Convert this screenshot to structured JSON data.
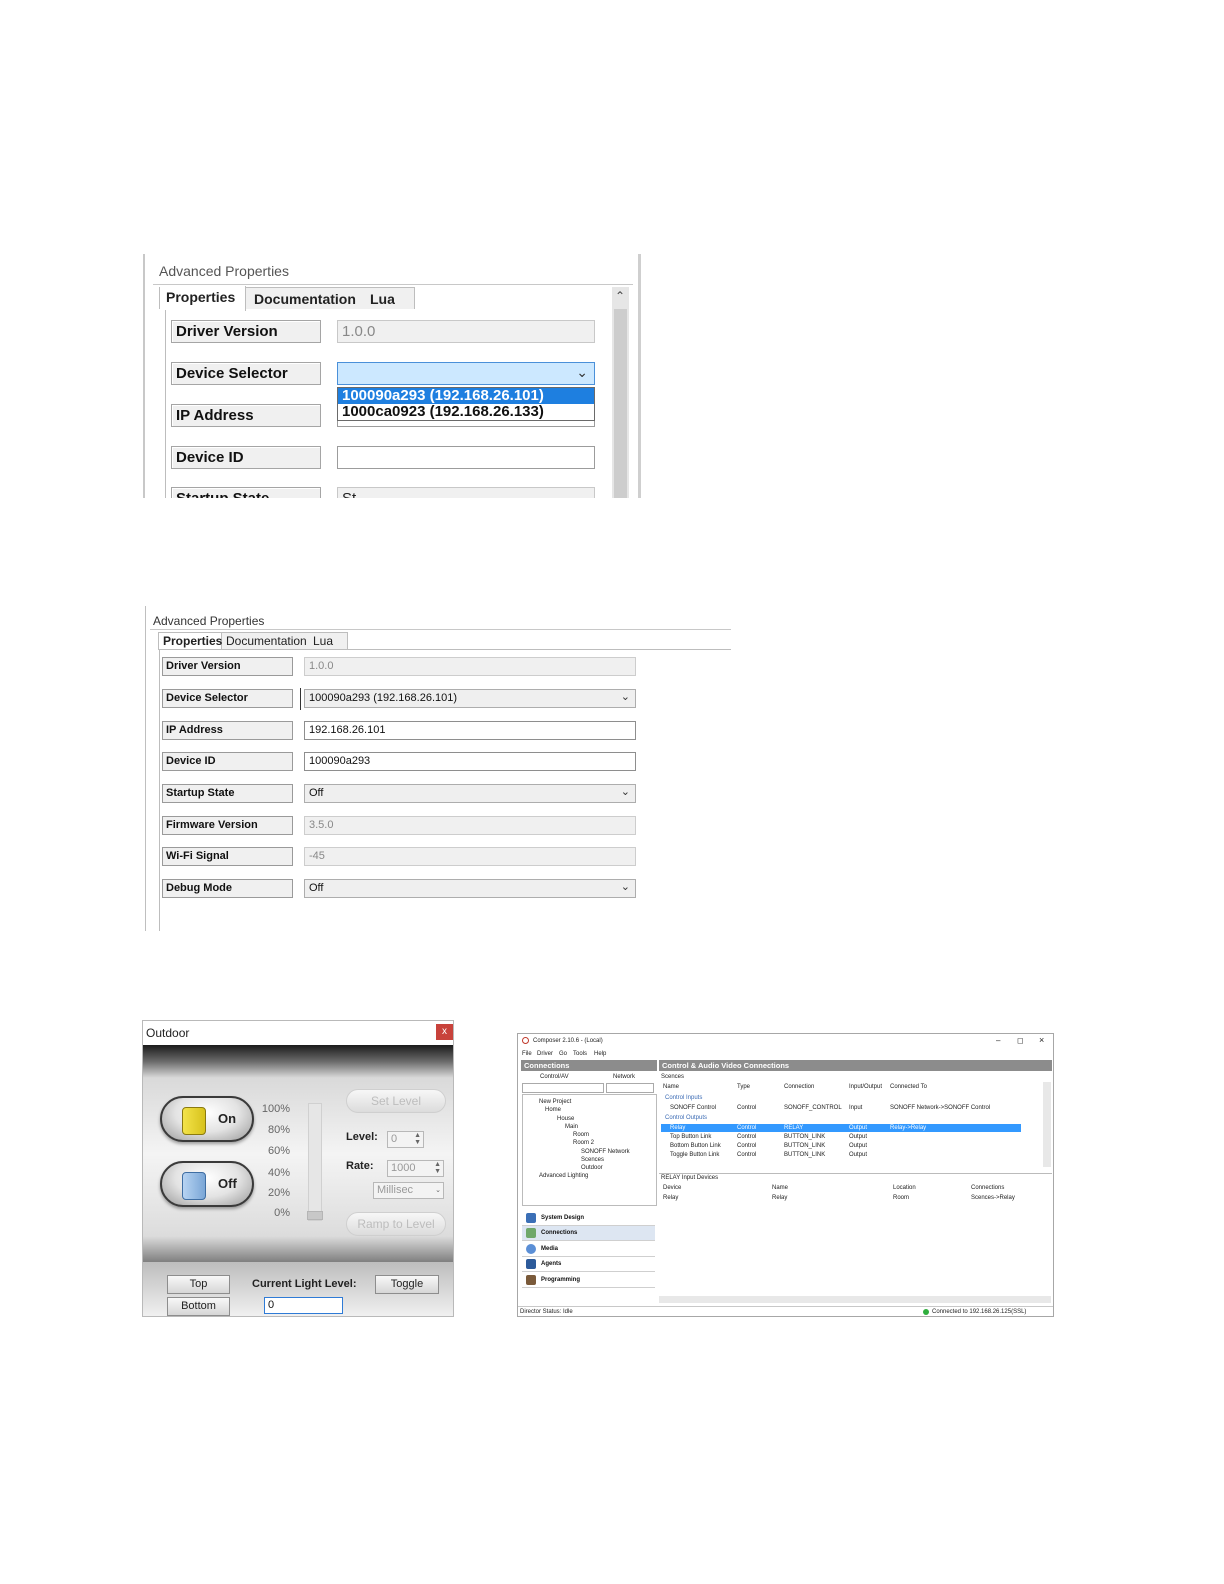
{
  "shot1": {
    "header": "Advanced Properties",
    "tabs": [
      "Properties",
      "Documentation",
      "Lua"
    ],
    "rows": [
      {
        "label": "Driver Version",
        "value": "1.0.0"
      },
      {
        "label": "Device Selector",
        "value": ""
      },
      {
        "label": "IP Address",
        "value": ""
      },
      {
        "label": "Device ID",
        "value": ""
      },
      {
        "label": "Startup State",
        "value": "St"
      }
    ],
    "dropdown_options": [
      "100090a293 (192.168.26.101)",
      "1000ca0923 (192.168.26.133)"
    ]
  },
  "shot2": {
    "header": "Advanced Properties",
    "tabs": [
      "Properties",
      "Documentation",
      "Lua"
    ],
    "rows": [
      {
        "label": "Driver Version",
        "value": "1.0.0"
      },
      {
        "label": "Device Selector",
        "value": "100090a293 (192.168.26.101)"
      },
      {
        "label": "IP Address",
        "value": "192.168.26.101"
      },
      {
        "label": "Device ID",
        "value": "100090a293"
      },
      {
        "label": "Startup State",
        "value": "Off"
      },
      {
        "label": "Firmware Version",
        "value": "3.5.0"
      },
      {
        "label": "Wi-Fi Signal",
        "value": "-45"
      },
      {
        "label": "Debug Mode",
        "value": "Off"
      }
    ]
  },
  "shot3": {
    "title": "Outdoor",
    "close": "x",
    "on_label": "On",
    "off_label": "Off",
    "ticks": [
      "100%",
      "80%",
      "60%",
      "40%",
      "20%",
      "0%"
    ],
    "set_level": "Set Level",
    "level_label": "Level:",
    "level_value": "0",
    "rate_label": "Rate:",
    "rate_value": "1000",
    "unit_value": "Millisec",
    "ramp": "Ramp to Level",
    "top": "Top",
    "bottom": "Bottom",
    "current_label": "Current Light Level:",
    "current_value": "0",
    "toggle": "Toggle",
    "slider_level": 0
  },
  "shot4": {
    "window_title": "Composer 2.10.6 - (Local)",
    "menu": [
      "File",
      "Driver",
      "Go",
      "Tools",
      "Help"
    ],
    "left_header": "Connections",
    "left_tabs": [
      "Control/AV",
      "Network"
    ],
    "tree": [
      "New Project",
      "Home",
      "House",
      "Main",
      "Room",
      "Room 2",
      "SONOFF Network",
      "Scences",
      "Outdoor",
      "Advanced Lighting"
    ],
    "nav": [
      "System Design",
      "Connections",
      "Media",
      "Agents",
      "Programming"
    ],
    "right_header": "Control & Audio Video Connections",
    "section_title": "Scences",
    "columns": [
      "Name",
      "Type",
      "Connection",
      "Input/Output",
      "Connected To"
    ],
    "control_inputs_label": "Control Inputs",
    "control_outputs_label": "Control Outputs",
    "inputs": [
      [
        "SONOFF Control",
        "Control",
        "SONOFF_CONTROL",
        "Input",
        "SONOFF Network->SONOFF Control"
      ]
    ],
    "outputs": [
      [
        "Relay",
        "Control",
        "RELAY",
        "Output",
        "Relay->Relay"
      ],
      [
        "Top Button Link",
        "Control",
        "BUTTON_LINK",
        "Output",
        ""
      ],
      [
        "Bottom Button Link",
        "Control",
        "BUTTON_LINK",
        "Output",
        ""
      ],
      [
        "Toggle Button Link",
        "Control",
        "BUTTON_LINK",
        "Output",
        ""
      ]
    ],
    "lower_title": "RELAY Input Devices",
    "lower_columns": [
      "Device",
      "Name",
      "Location",
      "Connections"
    ],
    "lower_rows": [
      [
        "Relay",
        "Relay",
        "Room",
        "Scences->Relay"
      ]
    ],
    "status_left": "Director Status: Idle",
    "status_right": "Connected to 192.168.26.125(SSL)",
    "colors": {
      "selection": "#3399ff",
      "header": "#8c8c8c"
    }
  }
}
